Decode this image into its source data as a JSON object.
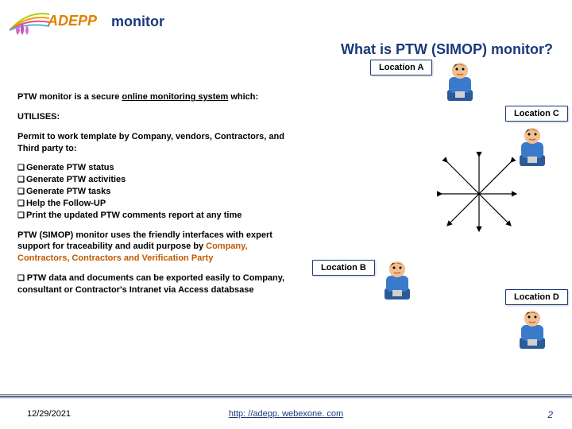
{
  "brand_logo_text": "ADEPP",
  "brand_word": "monitor",
  "title": "What is PTW (SIMOP) monitor?",
  "locations": {
    "a": "Location A",
    "b": "Location B",
    "c": "Location C",
    "d": "Location D"
  },
  "left": {
    "intro_pre": "PTW monitor is a secure ",
    "intro_mid": "online monitoring system",
    "intro_post": " which:",
    "utilises": "UTILISES:",
    "permit": "Permit to work template  by Company, vendors, Contractors, and Third party to:",
    "b1": "Generate PTW status",
    "b2": "Generate PTW activities",
    "b3": "Generate PTW tasks",
    "b4": "Help the Follow-UP",
    "b5": "Print the updated PTW comments report at any time",
    "desc_pre": "PTW (SIMOP) monitor uses the friendly interfaces  with expert support for traceability and audit purpose  by ",
    "desc_orange": "Company, Contractors, Contractors and Verification Party",
    "export": "PTW data and documents can be exported  easily to Company, consultant or Contractor's Intranet via Access databsase"
  },
  "footer": {
    "date": "12/29/2021",
    "link": "http: //adepp. webexone. com",
    "page": "2"
  },
  "colors": {
    "brand": "#1a3a7a",
    "orange": "#c05a00"
  }
}
